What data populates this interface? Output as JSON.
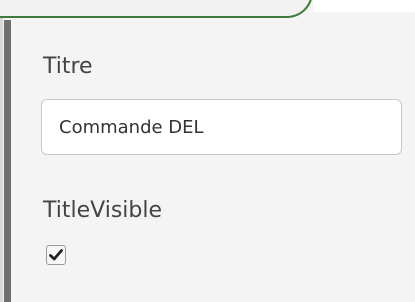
{
  "form": {
    "title_label": "Titre",
    "title_value": "Commande DEL",
    "visible_label": "TitleVisible",
    "visible_checked": true
  },
  "icons": {
    "checkbox_mark": "checkmark-icon"
  },
  "colors": {
    "accent_tab_border": "#3c7a3c",
    "panel_background": "#f4f4f4"
  }
}
